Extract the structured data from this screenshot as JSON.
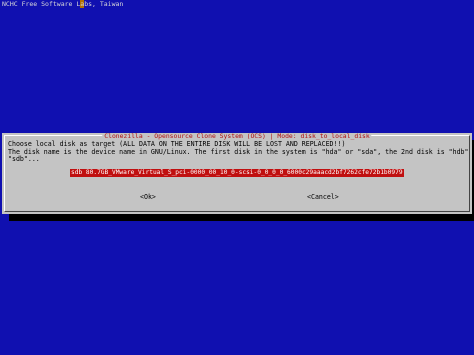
{
  "topbar": {
    "text_before": "NCHC Free Software L",
    "cursor_char": "a",
    "text_after": "bs, Taiwan"
  },
  "dialog": {
    "title": "Clonezilla - Opensource Clone System (OCS) | Mode: disk_to_local_disk",
    "message_lines": [
      "Choose local disk as target (ALL DATA ON THE ENTIRE DISK WILL BE LOST AND REPLACED!!)",
      "The disk name is the device name in GNU/Linux. The first disk in the system is \"hda\" or \"sda\", the 2nd disk is \"hdb\" or",
      "\"sdb\"..."
    ],
    "options": [
      "sdb 80.7GB_VMware_Virtual_S_pci-0000_00_10_0-scsi-0_0_0_0_6000c29aaacd2bf7262cfe72b1b0979"
    ],
    "ok_label": "<Ok>",
    "cancel_label": "<Cancel>"
  },
  "colors": {
    "background": "#1010b0",
    "dialog": "#c4c4c4",
    "title_text": "#b01010",
    "selection": "#c01010"
  }
}
